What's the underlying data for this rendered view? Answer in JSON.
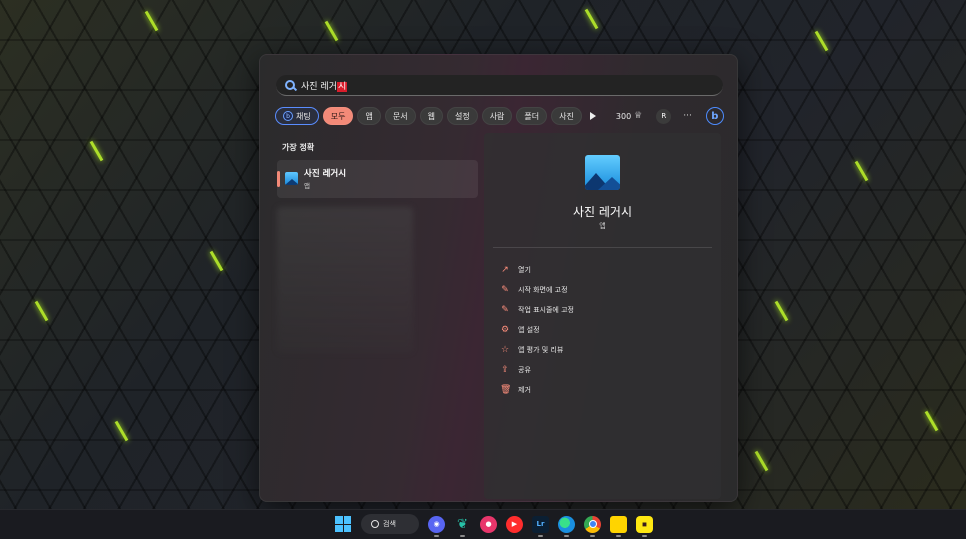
{
  "search": {
    "query_prefix": "사진 레거",
    "query_selected": "시"
  },
  "filters": {
    "chat": "채팅",
    "chips": [
      "모두",
      "앱",
      "문서",
      "웹",
      "설정",
      "사람",
      "폴더",
      "사진"
    ],
    "active_index": 0,
    "points": "300",
    "avatar_initial": "R",
    "more": "···",
    "bing_label": "b"
  },
  "results": {
    "section_title": "가장 정확",
    "best_match": {
      "name": "사진 레거시",
      "type": "앱"
    }
  },
  "details": {
    "title": "사진 레거시",
    "subtitle": "앱",
    "actions": [
      {
        "icon": "open-icon",
        "glyph": "↗",
        "label": "열기"
      },
      {
        "icon": "pin-icon",
        "glyph": "✎",
        "label": "시작 화면에 고정"
      },
      {
        "icon": "pin-icon",
        "glyph": "✎",
        "label": "작업 표시줄에 고정"
      },
      {
        "icon": "gear-icon",
        "glyph": "⚙",
        "label": "앱 설정"
      },
      {
        "icon": "star-icon",
        "glyph": "☆",
        "label": "앱 평가 및 리뷰"
      },
      {
        "icon": "share-icon",
        "glyph": "⇪",
        "label": "공유"
      },
      {
        "icon": "trash-icon",
        "glyph": "🗑",
        "label": "제거"
      }
    ]
  },
  "taskbar": {
    "search_label": "검색",
    "lightroom_label": "Lr"
  },
  "colors": {
    "accent": "#f38a78",
    "selection": "#d91d2b",
    "panel": "#2b2b2c"
  }
}
